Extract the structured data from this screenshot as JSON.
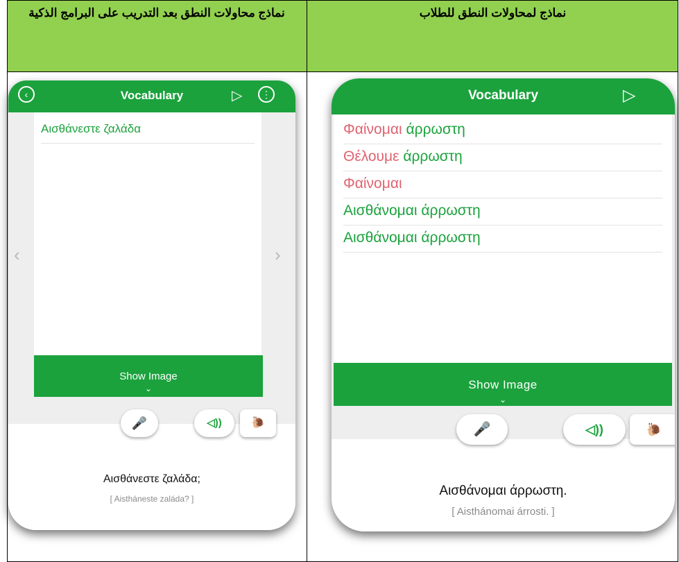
{
  "headers": {
    "left": "نماذج محاولات النطق بعد التدريب على البرامج الذكية",
    "right": "نماذج لمحاولات النطق للطلاب"
  },
  "colors": {
    "header_bg": "#92d050",
    "app_green": "#1ba23d",
    "wrong_red": "#e06370"
  },
  "left_phone": {
    "title": "Vocabulary",
    "icons": [
      "back-icon",
      "play-icon",
      "more-icon"
    ],
    "vocab": [
      {
        "text": "Αισθάνεστε ζαλάδα",
        "status": "correct"
      }
    ],
    "show_image": "Show Image",
    "chevron": "⌄",
    "prev_arrow": "‹",
    "next_arrow": "›",
    "mic_icon": "🎤",
    "speaker_icon": "◁))",
    "slow_icon": "🐌",
    "sentence": "Αισθάνεστε ζαλάδα;",
    "transliteration": "[ Aistháneste zaláda? ]"
  },
  "right_phone": {
    "title": "Vocabulary",
    "icons": [
      "play-icon"
    ],
    "vocab": [
      {
        "parts": [
          {
            "text": "Φαίνομαι",
            "status": "wrong"
          },
          {
            "text": " άρρωστη",
            "status": "correct"
          }
        ]
      },
      {
        "parts": [
          {
            "text": "Θέλουμε",
            "status": "wrong"
          },
          {
            "text": " άρρωστη",
            "status": "correct"
          }
        ]
      },
      {
        "parts": [
          {
            "text": "Φαίνομαι",
            "status": "wrong"
          }
        ]
      },
      {
        "parts": [
          {
            "text": "Αισθάνομαι άρρωστη",
            "status": "correct"
          }
        ]
      },
      {
        "parts": [
          {
            "text": "Αισθάνομαι άρρωστη",
            "status": "correct"
          }
        ]
      }
    ],
    "show_image": "Show Image",
    "chevron": "⌄",
    "mic_icon": "🎤",
    "speaker_icon": "◁))",
    "slow_icon": "🐌",
    "sentence": "Αισθάνομαι άρρωστη.",
    "transliteration": "[ Aisthánomai árrosti. ]"
  }
}
